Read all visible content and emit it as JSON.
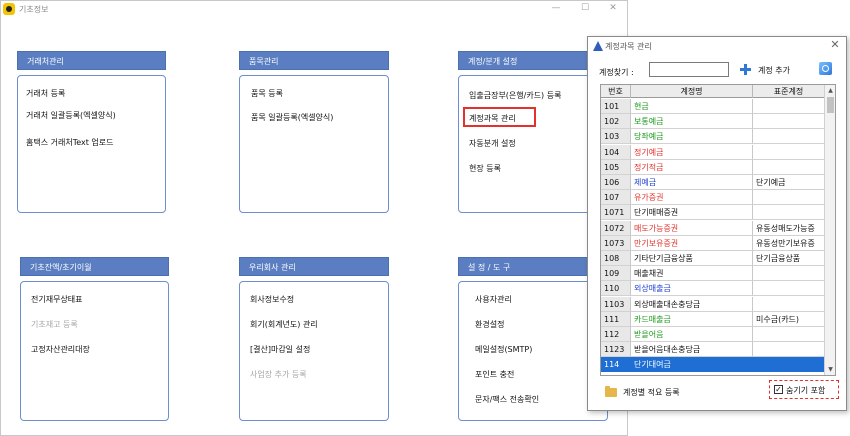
{
  "window": {
    "title": "기초정보",
    "controls": [
      "—",
      "☐",
      "✕"
    ]
  },
  "panels": [
    {
      "title": "거래처관리",
      "items": [
        {
          "label": "거래처 등록",
          "disabled": false
        },
        {
          "label": "거래처 일괄등록(엑셀양식)",
          "disabled": false
        },
        {
          "label": "홈택스 거래처Text 업로드",
          "disabled": false
        }
      ]
    },
    {
      "title": "품목관리",
      "items": [
        {
          "label": "품목 등록",
          "disabled": false
        },
        {
          "label": "품목 일괄등록(엑셀양식)",
          "disabled": false
        }
      ]
    },
    {
      "title": "계정/분개 설정",
      "items": [
        {
          "label": "입출금장부(은행/카드) 등록",
          "disabled": false
        },
        {
          "label": "계정과목 관리",
          "disabled": false,
          "highlighted": true
        },
        {
          "label": "자동분개 설정",
          "disabled": false
        },
        {
          "label": "현장 등록",
          "disabled": false
        }
      ]
    },
    {
      "title": "기초잔액/초기이월",
      "items": [
        {
          "label": "전기재무상태표",
          "disabled": false
        },
        {
          "label": "기초재고 등록",
          "disabled": true
        },
        {
          "label": "고정자산관리대장",
          "disabled": false
        }
      ]
    },
    {
      "title": "우리회사 관리",
      "items": [
        {
          "label": "회사정보수정",
          "disabled": false
        },
        {
          "label": "회기(회계년도) 관리",
          "disabled": false
        },
        {
          "label": "[결산]마감일 설정",
          "disabled": false
        },
        {
          "label": "사업장 추가 등록",
          "disabled": true
        }
      ]
    },
    {
      "title": "설 정 / 도 구",
      "items": [
        {
          "label": "사용자관리",
          "disabled": false
        },
        {
          "label": "환경설정",
          "disabled": false
        },
        {
          "label": "메일설정(SMTP)",
          "disabled": false
        },
        {
          "label": "포인트 충전",
          "disabled": false
        },
        {
          "label": "문자/팩스 전송확인",
          "disabled": false
        }
      ]
    }
  ],
  "dialog": {
    "title": "계정과목 관리",
    "close": "✕",
    "search_label": "계정찾기 :",
    "search_value": "",
    "add_label": "계정 추가",
    "columns": [
      "번호",
      "계정명",
      "표준계정"
    ],
    "rows": [
      {
        "code": "101",
        "name": "현금",
        "std": "",
        "color": "#1a9a1a"
      },
      {
        "code": "102",
        "name": "보통예금",
        "std": "",
        "color": "#1a9a1a"
      },
      {
        "code": "103",
        "name": "당좌예금",
        "std": "",
        "color": "#1a9a1a"
      },
      {
        "code": "104",
        "name": "정기예금",
        "std": "",
        "color": "#e3312b"
      },
      {
        "code": "105",
        "name": "정기적금",
        "std": "",
        "color": "#e3312b"
      },
      {
        "code": "106",
        "name": "제예금",
        "std": "단기예금",
        "color": "#1f3fd0"
      },
      {
        "code": "107",
        "name": "유가증권",
        "std": "",
        "color": "#e3312b"
      },
      {
        "code": "1071",
        "name": "단기매매증권",
        "std": "",
        "color": "#111111"
      },
      {
        "code": "1072",
        "name": "매도가능증권",
        "std": "유동성매도가능증",
        "color": "#e3312b"
      },
      {
        "code": "1073",
        "name": "만기보유증권",
        "std": "유동성만기보유증",
        "color": "#e3312b"
      },
      {
        "code": "108",
        "name": "기타단기금융상품",
        "std": "단기금융상품",
        "color": "#111111"
      },
      {
        "code": "109",
        "name": "매출채권",
        "std": "",
        "color": "#111111"
      },
      {
        "code": "110",
        "name": "외상매출금",
        "std": "",
        "color": "#1f3fd0"
      },
      {
        "code": "1103",
        "name": "외상매출대손충당금",
        "std": "",
        "color": "#111111"
      },
      {
        "code": "111",
        "name": "카드매출금",
        "std": "미수금(카드)",
        "color": "#1a9a1a"
      },
      {
        "code": "112",
        "name": "받을어음",
        "std": "",
        "color": "#1a9a1a"
      },
      {
        "code": "1123",
        "name": "받을어음대손충당금",
        "std": "",
        "color": "#111111"
      },
      {
        "code": "114",
        "name": "단기대여금",
        "std": "",
        "color": "#ffffff",
        "selected": true
      }
    ],
    "bottom_label": "계정별 적요 등록",
    "checkbox_label": "숨기기 포함",
    "checkbox_checked": true
  }
}
